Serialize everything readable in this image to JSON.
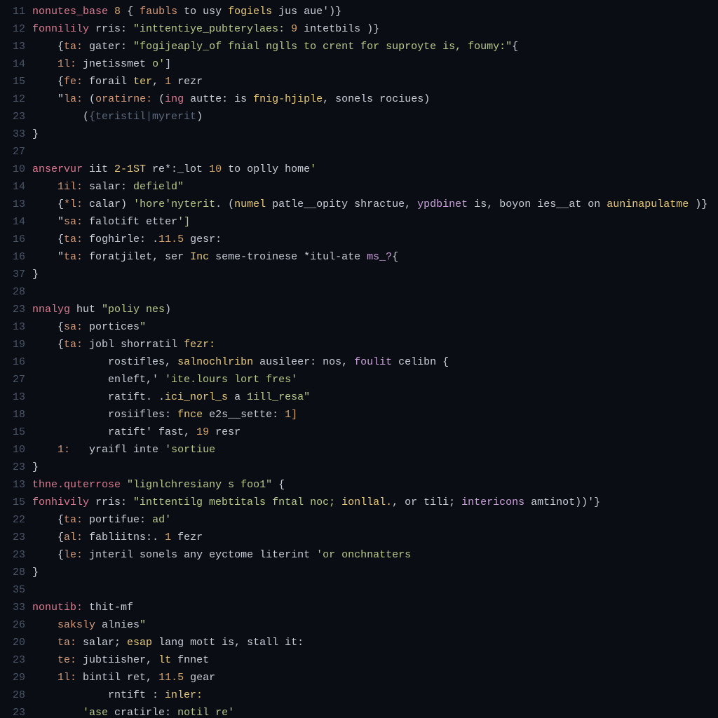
{
  "gutter": [
    "11",
    "12",
    "13",
    "14",
    "15",
    "12",
    "23",
    "33",
    "27",
    "10",
    "14",
    "13",
    "14",
    "16",
    "16",
    "37",
    "28",
    "23",
    "13",
    "19",
    "16",
    "27",
    "13",
    "18",
    "15",
    "10",
    "23",
    "13",
    "15",
    "22",
    "23",
    "23",
    "28",
    "35",
    "33",
    "26",
    "20",
    "23",
    "29",
    "28",
    "23"
  ],
  "lines": [
    {
      "indent": 0,
      "tokens": [
        {
          "t": "nonutes_base",
          "c": "kw"
        },
        {
          "t": " ",
          "c": "pun"
        },
        {
          "t": "8",
          "c": "num"
        },
        {
          "t": " { ",
          "c": "pun"
        },
        {
          "t": "faubls",
          "c": "key"
        },
        {
          "t": " to usy ",
          "c": "id"
        },
        {
          "t": "fogiels",
          "c": "fn"
        },
        {
          "t": " jus aue",
          "c": "id"
        },
        {
          "t": "')}",
          "c": "pun"
        }
      ]
    },
    {
      "indent": 0,
      "tokens": [
        {
          "t": "fonnilily",
          "c": "kw"
        },
        {
          "t": " rris: ",
          "c": "id"
        },
        {
          "t": "\"inttentiye_pubterylaes: ",
          "c": "str"
        },
        {
          "t": "9",
          "c": "num"
        },
        {
          "t": " intetbils",
          "c": "id"
        },
        {
          "t": " )}",
          "c": "pun"
        }
      ]
    },
    {
      "indent": 1,
      "tokens": [
        {
          "t": "{",
          "c": "pun"
        },
        {
          "t": "ta:",
          "c": "key"
        },
        {
          "t": " gater: ",
          "c": "id"
        },
        {
          "t": "\"fogijeaply_of fnial nglls to crent for suproyte is, foumy:\"",
          "c": "str"
        },
        {
          "t": "{",
          "c": "pun"
        }
      ]
    },
    {
      "indent": 1,
      "tokens": [
        {
          "t": "1l:",
          "c": "key"
        },
        {
          "t": " jnetissmet ",
          "c": "id"
        },
        {
          "t": "o'",
          "c": "str"
        },
        {
          "t": "]",
          "c": "pun"
        }
      ]
    },
    {
      "indent": 1,
      "tokens": [
        {
          "t": "{",
          "c": "pun"
        },
        {
          "t": "fe:",
          "c": "key"
        },
        {
          "t": " forail ",
          "c": "id"
        },
        {
          "t": "ter",
          "c": "fn"
        },
        {
          "t": ", ",
          "c": "pun"
        },
        {
          "t": "1",
          "c": "num"
        },
        {
          "t": " rezr",
          "c": "id"
        }
      ]
    },
    {
      "indent": 1,
      "tokens": [
        {
          "t": "\"",
          "c": "pun"
        },
        {
          "t": "la:",
          "c": "key"
        },
        {
          "t": " (",
          "c": "pun"
        },
        {
          "t": "oratirne:",
          "c": "key"
        },
        {
          "t": " (",
          "c": "pun"
        },
        {
          "t": "ing",
          "c": "kw"
        },
        {
          "t": " autte: is ",
          "c": "id"
        },
        {
          "t": "fnig-hjiple",
          "c": "fn"
        },
        {
          "t": ", sonels rociues)",
          "c": "id"
        }
      ]
    },
    {
      "indent": 2,
      "tokens": [
        {
          "t": "(",
          "c": "pun"
        },
        {
          "t": "{teristil|myrerit",
          "c": "cm"
        },
        {
          "t": ")",
          "c": "pun"
        }
      ]
    },
    {
      "indent": 0,
      "tokens": [
        {
          "t": "}",
          "c": "pun"
        }
      ]
    },
    {
      "indent": 0,
      "tokens": [
        {
          "t": "",
          "c": "pun"
        }
      ]
    },
    {
      "indent": 0,
      "tokens": [
        {
          "t": "anservur",
          "c": "kw"
        },
        {
          "t": " iit ",
          "c": "id"
        },
        {
          "t": "2-1ST",
          "c": "fn"
        },
        {
          "t": " re*:_lot ",
          "c": "id"
        },
        {
          "t": "10",
          "c": "num"
        },
        {
          "t": " to oplly home",
          "c": "id"
        },
        {
          "t": "'",
          "c": "str"
        }
      ]
    },
    {
      "indent": 1,
      "tokens": [
        {
          "t": "1il:",
          "c": "key"
        },
        {
          "t": " salar: ",
          "c": "id"
        },
        {
          "t": "defield\"",
          "c": "str"
        }
      ]
    },
    {
      "indent": 1,
      "tokens": [
        {
          "t": "{",
          "c": "pun"
        },
        {
          "t": "*l:",
          "c": "key"
        },
        {
          "t": " calar) ",
          "c": "id"
        },
        {
          "t": "'hore'nyterit",
          "c": "str"
        },
        {
          "t": ". (",
          "c": "pun"
        },
        {
          "t": "numel",
          "c": "fn"
        },
        {
          "t": " patle__opity shractue, ",
          "c": "id"
        },
        {
          "t": "ypdbinet",
          "c": "alt"
        },
        {
          "t": " is, boyon ies__at on ",
          "c": "id"
        },
        {
          "t": "auninapulatme",
          "c": "fn"
        },
        {
          "t": " )}",
          "c": "pun"
        }
      ]
    },
    {
      "indent": 1,
      "tokens": [
        {
          "t": "\"",
          "c": "pun"
        },
        {
          "t": "sa:",
          "c": "key"
        },
        {
          "t": " falotift etter",
          "c": "id"
        },
        {
          "t": "']",
          "c": "str"
        }
      ]
    },
    {
      "indent": 1,
      "tokens": [
        {
          "t": "{",
          "c": "pun"
        },
        {
          "t": "ta:",
          "c": "key"
        },
        {
          "t": " foghirle: .",
          "c": "id"
        },
        {
          "t": "11.5",
          "c": "num"
        },
        {
          "t": " gesr:",
          "c": "id"
        }
      ]
    },
    {
      "indent": 1,
      "tokens": [
        {
          "t": "\"",
          "c": "pun"
        },
        {
          "t": "ta:",
          "c": "key"
        },
        {
          "t": " foratjilet, ser ",
          "c": "id"
        },
        {
          "t": "Inc",
          "c": "fn"
        },
        {
          "t": " seme-troinese *itul-ate ",
          "c": "id"
        },
        {
          "t": "ms_?",
          "c": "alt"
        },
        {
          "t": "{",
          "c": "pun"
        }
      ]
    },
    {
      "indent": 0,
      "tokens": [
        {
          "t": "}",
          "c": "pun"
        }
      ]
    },
    {
      "indent": 0,
      "tokens": [
        {
          "t": "",
          "c": "pun"
        }
      ]
    },
    {
      "indent": 0,
      "tokens": [
        {
          "t": "nnalyg",
          "c": "kw"
        },
        {
          "t": " hut ",
          "c": "id"
        },
        {
          "t": "\"poliy nes",
          "c": "str"
        },
        {
          "t": ")",
          "c": "pun"
        }
      ]
    },
    {
      "indent": 1,
      "tokens": [
        {
          "t": "{",
          "c": "pun"
        },
        {
          "t": "sa:",
          "c": "key"
        },
        {
          "t": " portices",
          "c": "id"
        },
        {
          "t": "\"",
          "c": "str"
        }
      ]
    },
    {
      "indent": 1,
      "tokens": [
        {
          "t": "{",
          "c": "pun"
        },
        {
          "t": "ta:",
          "c": "key"
        },
        {
          "t": " jobl shorratil ",
          "c": "id"
        },
        {
          "t": "fezr:",
          "c": "fn"
        }
      ]
    },
    {
      "indent": 3,
      "tokens": [
        {
          "t": "rostifles, ",
          "c": "id"
        },
        {
          "t": "salnochlribn",
          "c": "fn"
        },
        {
          "t": " ausileer: nos, ",
          "c": "id"
        },
        {
          "t": "foulit",
          "c": "alt"
        },
        {
          "t": " celibn {",
          "c": "id"
        }
      ]
    },
    {
      "indent": 3,
      "tokens": [
        {
          "t": "enleft,' ",
          "c": "id"
        },
        {
          "t": "'ite.lours lort fres'",
          "c": "str"
        }
      ]
    },
    {
      "indent": 3,
      "tokens": [
        {
          "t": "ratift. .",
          "c": "id"
        },
        {
          "t": "ici_norl_s",
          "c": "fn"
        },
        {
          "t": " a ",
          "c": "id"
        },
        {
          "t": "1ill_resa\"",
          "c": "str"
        }
      ]
    },
    {
      "indent": 3,
      "tokens": [
        {
          "t": "rosiifles: ",
          "c": "id"
        },
        {
          "t": "fnce",
          "c": "fn"
        },
        {
          "t": " e2s__sette: ",
          "c": "id"
        },
        {
          "t": "1]",
          "c": "num"
        }
      ]
    },
    {
      "indent": 3,
      "tokens": [
        {
          "t": "ratift' fast, ",
          "c": "id"
        },
        {
          "t": "19",
          "c": "num"
        },
        {
          "t": " resr",
          "c": "id"
        }
      ]
    },
    {
      "indent": 1,
      "tokens": [
        {
          "t": "1:",
          "c": "key"
        },
        {
          "t": "   yraifl inte ",
          "c": "id"
        },
        {
          "t": "'sortiue",
          "c": "str"
        }
      ]
    },
    {
      "indent": 0,
      "tokens": [
        {
          "t": "}",
          "c": "pun"
        }
      ]
    },
    {
      "indent": 0,
      "tokens": [
        {
          "t": "thne.quterrose",
          "c": "kw"
        },
        {
          "t": " ",
          "c": "pun"
        },
        {
          "t": "\"lignlchresiany s foo1\"",
          "c": "str"
        },
        {
          "t": " {",
          "c": "pun"
        }
      ]
    },
    {
      "indent": 0,
      "tokens": [
        {
          "t": "fonhivily",
          "c": "kw"
        },
        {
          "t": " rris: ",
          "c": "id"
        },
        {
          "t": "\"inttentilg mebtitals fntal noc; ",
          "c": "str"
        },
        {
          "t": "ionllal.",
          "c": "fn"
        },
        {
          "t": ", or tili; ",
          "c": "id"
        },
        {
          "t": "intericons",
          "c": "alt"
        },
        {
          "t": " amtinot)",
          "c": "id"
        },
        {
          "t": ")'}",
          "c": "pun"
        }
      ]
    },
    {
      "indent": 1,
      "tokens": [
        {
          "t": "{",
          "c": "pun"
        },
        {
          "t": "ta:",
          "c": "key"
        },
        {
          "t": " portifue: ",
          "c": "id"
        },
        {
          "t": "ad'",
          "c": "str"
        }
      ]
    },
    {
      "indent": 1,
      "tokens": [
        {
          "t": "{",
          "c": "pun"
        },
        {
          "t": "al:",
          "c": "key"
        },
        {
          "t": " fabliitns:. ",
          "c": "id"
        },
        {
          "t": "1",
          "c": "num"
        },
        {
          "t": " fezr",
          "c": "id"
        }
      ]
    },
    {
      "indent": 1,
      "tokens": [
        {
          "t": "{",
          "c": "pun"
        },
        {
          "t": "le:",
          "c": "key"
        },
        {
          "t": " jnteril sonels any eyctome literint ",
          "c": "id"
        },
        {
          "t": "'or onchnatters",
          "c": "str"
        }
      ]
    },
    {
      "indent": 0,
      "tokens": [
        {
          "t": "}",
          "c": "pun"
        }
      ]
    },
    {
      "indent": 0,
      "tokens": [
        {
          "t": "",
          "c": "pun"
        }
      ]
    },
    {
      "indent": 0,
      "tokens": [
        {
          "t": "nonutib:",
          "c": "kw"
        },
        {
          "t": " thit-mf",
          "c": "id"
        }
      ]
    },
    {
      "indent": 1,
      "tokens": [
        {
          "t": "saksly",
          "c": "key"
        },
        {
          "t": " alnies",
          "c": "id"
        },
        {
          "t": "\"",
          "c": "str"
        }
      ]
    },
    {
      "indent": 1,
      "tokens": [
        {
          "t": "ta:",
          "c": "key"
        },
        {
          "t": " salar; ",
          "c": "id"
        },
        {
          "t": "esap",
          "c": "fn"
        },
        {
          "t": " lang mott is, stall it:",
          "c": "id"
        }
      ]
    },
    {
      "indent": 1,
      "tokens": [
        {
          "t": "te:",
          "c": "key"
        },
        {
          "t": " jubtiisher, ",
          "c": "id"
        },
        {
          "t": "lt",
          "c": "fn"
        },
        {
          "t": " fnnet",
          "c": "id"
        }
      ]
    },
    {
      "indent": 1,
      "tokens": [
        {
          "t": "1l:",
          "c": "key"
        },
        {
          "t": " bintil ret, ",
          "c": "id"
        },
        {
          "t": "11.5",
          "c": "num"
        },
        {
          "t": " gear",
          "c": "id"
        }
      ]
    },
    {
      "indent": 3,
      "tokens": [
        {
          "t": "rntift : ",
          "c": "id"
        },
        {
          "t": "inler:",
          "c": "fn"
        }
      ]
    },
    {
      "indent": 2,
      "tokens": [
        {
          "t": "'ase",
          "c": "str"
        },
        {
          "t": " cratirle: ",
          "c": "id"
        },
        {
          "t": "notil re'",
          "c": "str"
        }
      ]
    }
  ]
}
